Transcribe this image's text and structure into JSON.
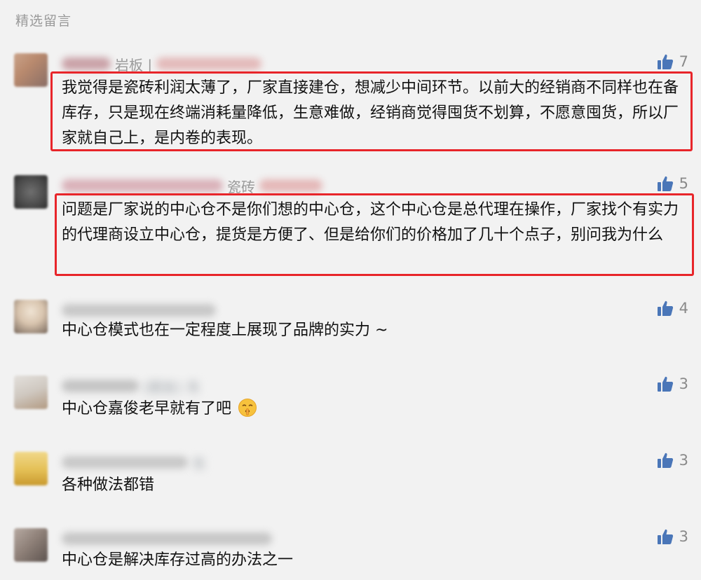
{
  "section_title": "精选留言",
  "colors": {
    "highlight": "#e8252a",
    "like_icon": "#4a76b8",
    "meta": "#9a9a9a"
  },
  "comments": [
    {
      "nickname_visible": "岩板 |",
      "likes": "7",
      "text": "我觉得是瓷砖利润太薄了，厂家直接建仓，想减少中间环节。以前大的经销商不同样也在备库存，只是现在终端消耗量降低，生意难做，经销商觉得囤货不划算，不愿意囤货，所以厂家就自己上，是内卷的表现。",
      "highlighted": true
    },
    {
      "nickname_visible": "瓷砖",
      "likes": "5",
      "text": "问题是厂家说的中心仓不是你们想的中心仓，这个中心仓是总代理在操作，厂家找个有实力的代理商设立中心仓，提货是方便了、但是给你们的价格加了几十个点子，别问我为什么",
      "highlighted": true
    },
    {
      "nickname_visible": "",
      "likes": "4",
      "text": "中心仓模式也在一定程度上展现了品牌的实力 ~",
      "highlighted": false
    },
    {
      "nickname_visible": "(朋友)  东",
      "likes": "3",
      "text": "中心仓嘉俊老早就有了吧",
      "emoji": "shushing-face-emoji",
      "highlighted": false
    },
    {
      "nickname_visible": "东",
      "likes": "3",
      "text": "各种做法都错",
      "highlighted": false
    },
    {
      "nickname_visible": "",
      "likes": "3",
      "text": "中心仓是解决库存过高的办法之一",
      "highlighted": false
    }
  ]
}
